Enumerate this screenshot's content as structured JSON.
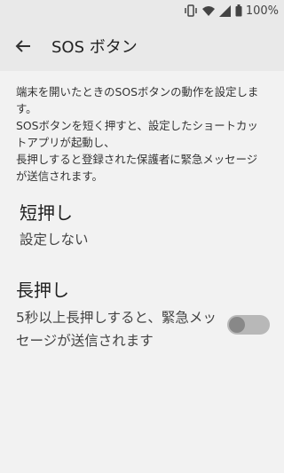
{
  "status_bar": {
    "battery_text": "100%"
  },
  "app_bar": {
    "title": "SOS ボタン"
  },
  "description": "端末を開いたときのSOSボタンの動作を設定します。\nSOSボタンを短く押すと、設定したショートカットアプリが起動し、\n長押しすると登録された保護者に緊急メッセージが送信されます。",
  "short_press": {
    "title": "短押し",
    "summary": "設定しない"
  },
  "long_press": {
    "title": "長押し",
    "summary": "5秒以上長押しすると、緊急メッセージが送信されます",
    "toggle_on": false
  }
}
